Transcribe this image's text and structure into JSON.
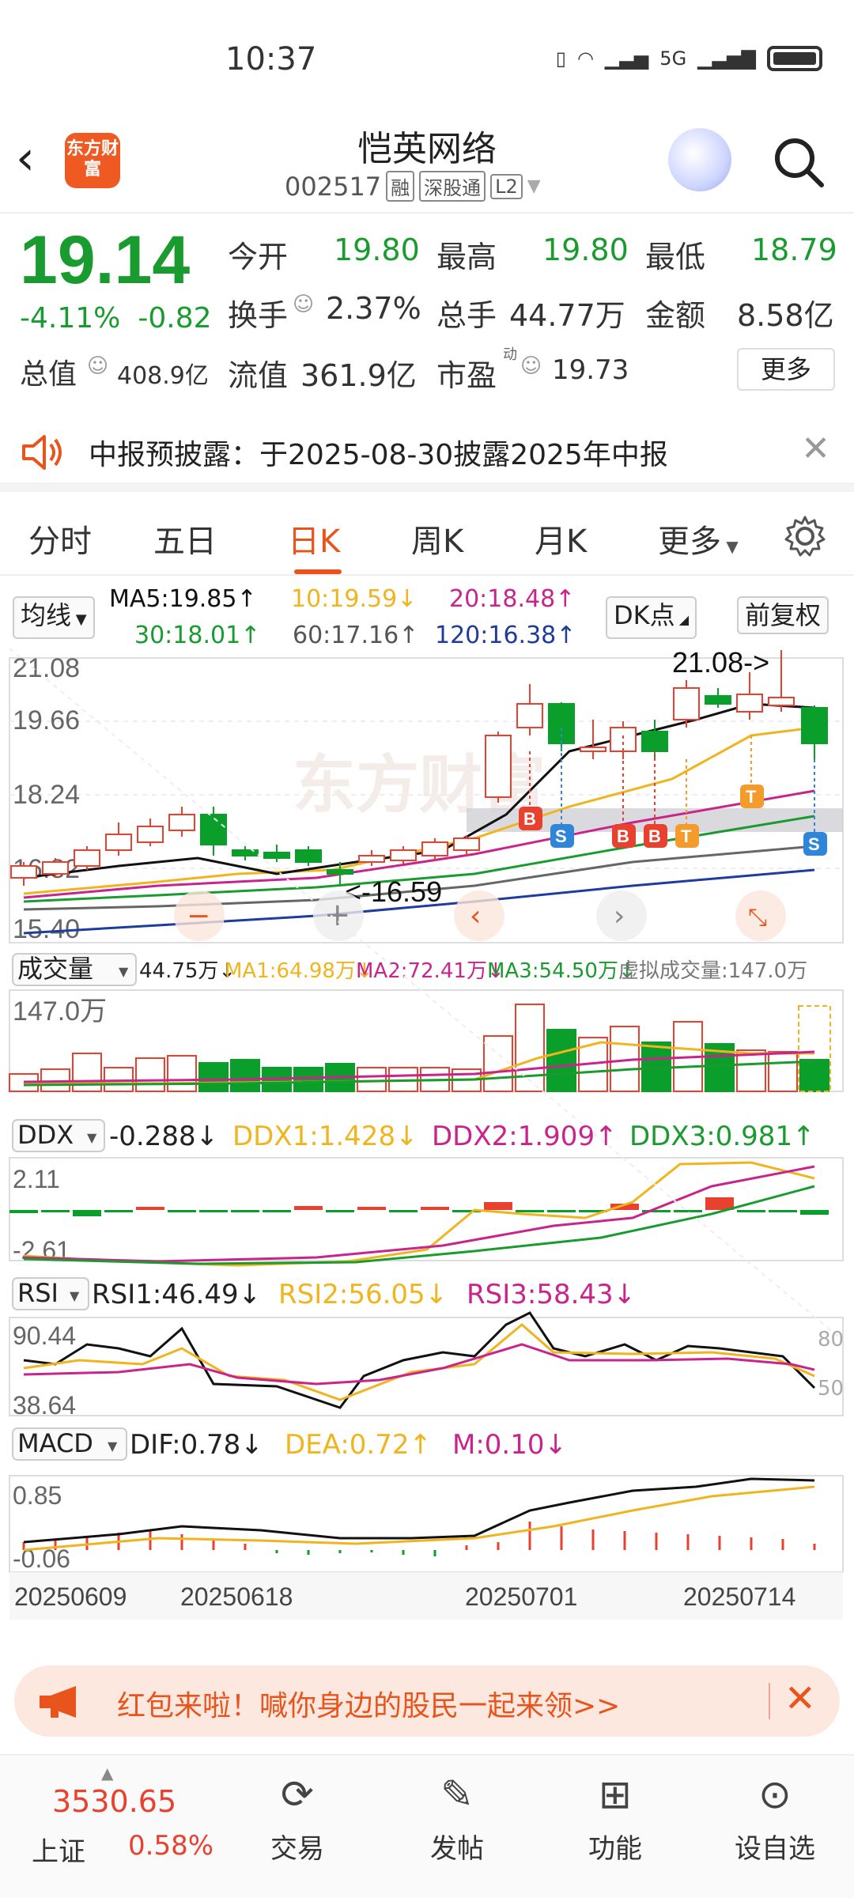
{
  "status_bar": {
    "time": "10:37",
    "network": "5G"
  },
  "header": {
    "title": "恺英网络",
    "code": "002517",
    "tags": [
      "融",
      "深股通",
      "L2"
    ],
    "logo_text": "东方财富"
  },
  "quote": {
    "price": "19.14",
    "change_pct": "-4.11%",
    "change": "-0.82",
    "open_label": "今开",
    "open": "19.80",
    "high_label": "最高",
    "high": "19.80",
    "low_label": "最低",
    "low": "18.79",
    "turnover_label": "换手",
    "turnover": "2.37%",
    "volume_label": "总手",
    "volume": "44.77万",
    "amount_label": "金额",
    "amount": "8.58亿",
    "mktcap_label": "总值",
    "mktcap": "408.9亿",
    "float_label": "流值",
    "float": "361.9亿",
    "pe_label": "市盈",
    "pe_sup": "动",
    "pe": "19.73",
    "more": "更多"
  },
  "notice": {
    "text": "中报预披露：于2025-08-30披露2025年中报"
  },
  "tabs": [
    "分时",
    "五日",
    "日K",
    "周K",
    "月K",
    "更多"
  ],
  "active_tab": "日K",
  "ma": {
    "selector": "均线",
    "ma5": "MA5:19.85↑",
    "ma10": "10:19.59↓",
    "ma20": "20:18.48↑",
    "ma30": "30:18.01↑",
    "ma60": "60:17.16↑",
    "ma120": "120:16.38↑",
    "dk_button": "DK点",
    "adjust_button": "前复权"
  },
  "kline": {
    "y_labels": [
      "21.08",
      "19.66",
      "18.24",
      "16.82",
      "15.40"
    ],
    "high_marker": "21.08->",
    "low_marker": "<-16.59",
    "signals": [
      "B",
      "S",
      "B",
      "B",
      "T",
      "T",
      "S"
    ],
    "watermark": "东方财富"
  },
  "volume": {
    "selector": "成交量",
    "value": "44.75万↓",
    "ma1": "MA1:64.98万↓",
    "ma2": "MA2:72.41万↓",
    "ma3": "MA3:54.50万↓",
    "virtual": "虚拟成交量:147.0万",
    "y_max": "147.0万"
  },
  "ddx": {
    "selector": "DDX",
    "value": "-0.288↓",
    "ddx1": "DDX1:1.428↓",
    "ddx2": "DDX2:1.909↑",
    "ddx3": "DDX3:0.981↑",
    "y_max": "2.11",
    "y_min": "-2.61"
  },
  "rsi": {
    "selector": "RSI",
    "rsi1": "RSI1:46.49↓",
    "rsi2": "RSI2:56.05↓",
    "rsi3": "RSI3:58.43↓",
    "y_max": "90.44",
    "y_min": "38.64",
    "ref80": "80",
    "ref50": "50"
  },
  "macd": {
    "selector": "MACD",
    "dif": "DIF:0.78↓",
    "dea": "DEA:0.72↑",
    "m": "M:0.10↓",
    "y_max": "0.85",
    "y_min": "-0.06"
  },
  "dates": [
    "20250609",
    "20250618",
    "20250701",
    "20250714"
  ],
  "promo": {
    "text": "红包来啦！喊你身边的股民一起来领>>"
  },
  "bottom_nav": {
    "index_value": "3530.65",
    "index_name": "上证",
    "index_pct": "0.58%",
    "items": [
      "交易",
      "发帖",
      "功能",
      "设自选"
    ]
  },
  "colors": {
    "up": "#e8412f",
    "down": "#0a9e2a",
    "accent": "#e8541b",
    "ma10": "#f0b41e",
    "ma20": "#c8248c",
    "ma30": "#1a9b2f",
    "ma60": "#666666",
    "ma120": "#1f3b9e"
  }
}
